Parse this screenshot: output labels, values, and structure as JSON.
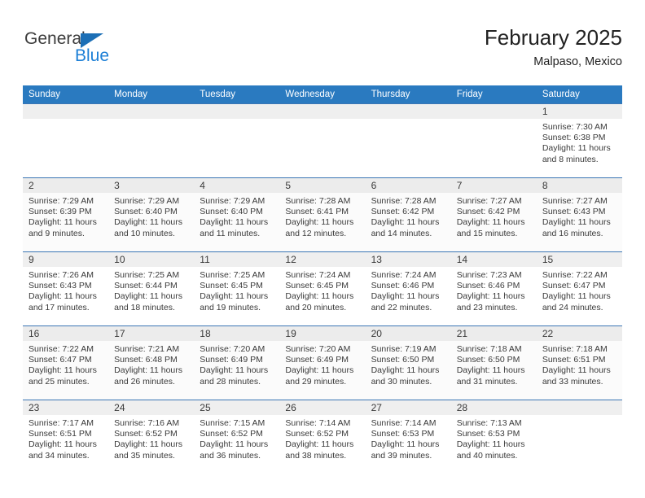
{
  "brand": {
    "name_top": "General",
    "name_bottom": "Blue",
    "accent_color": "#1c7fd6",
    "triangle_color": "#1c6fb6"
  },
  "header": {
    "title": "February 2025",
    "subtitle": "Malpaso, Mexico"
  },
  "theme": {
    "header_bg": "#2a7ac0",
    "row_border": "#3b76b5",
    "daynum_bg": "#efefef",
    "text": "#3a3a3a"
  },
  "weekday_headers": [
    "Sunday",
    "Monday",
    "Tuesday",
    "Wednesday",
    "Thursday",
    "Friday",
    "Saturday"
  ],
  "labels": {
    "sunrise": "Sunrise:",
    "sunset": "Sunset:",
    "daylight": "Daylight:"
  },
  "weeks": [
    {
      "shaded": false,
      "days": [
        {
          "date": "",
          "empty": true,
          "sunrise": "",
          "sunset": "",
          "daylight_1": "",
          "daylight_2": ""
        },
        {
          "date": "",
          "empty": true,
          "sunrise": "",
          "sunset": "",
          "daylight_1": "",
          "daylight_2": ""
        },
        {
          "date": "",
          "empty": true,
          "sunrise": "",
          "sunset": "",
          "daylight_1": "",
          "daylight_2": ""
        },
        {
          "date": "",
          "empty": true,
          "sunrise": "",
          "sunset": "",
          "daylight_1": "",
          "daylight_2": ""
        },
        {
          "date": "",
          "empty": true,
          "sunrise": "",
          "sunset": "",
          "daylight_1": "",
          "daylight_2": ""
        },
        {
          "date": "",
          "empty": true,
          "sunrise": "",
          "sunset": "",
          "daylight_1": "",
          "daylight_2": ""
        },
        {
          "date": "1",
          "empty": false,
          "sunrise": "Sunrise: 7:30 AM",
          "sunset": "Sunset: 6:38 PM",
          "daylight_1": "Daylight: 11 hours",
          "daylight_2": "and 8 minutes."
        }
      ]
    },
    {
      "shaded": true,
      "days": [
        {
          "date": "2",
          "empty": false,
          "sunrise": "Sunrise: 7:29 AM",
          "sunset": "Sunset: 6:39 PM",
          "daylight_1": "Daylight: 11 hours",
          "daylight_2": "and 9 minutes."
        },
        {
          "date": "3",
          "empty": false,
          "sunrise": "Sunrise: 7:29 AM",
          "sunset": "Sunset: 6:40 PM",
          "daylight_1": "Daylight: 11 hours",
          "daylight_2": "and 10 minutes."
        },
        {
          "date": "4",
          "empty": false,
          "sunrise": "Sunrise: 7:29 AM",
          "sunset": "Sunset: 6:40 PM",
          "daylight_1": "Daylight: 11 hours",
          "daylight_2": "and 11 minutes."
        },
        {
          "date": "5",
          "empty": false,
          "sunrise": "Sunrise: 7:28 AM",
          "sunset": "Sunset: 6:41 PM",
          "daylight_1": "Daylight: 11 hours",
          "daylight_2": "and 12 minutes."
        },
        {
          "date": "6",
          "empty": false,
          "sunrise": "Sunrise: 7:28 AM",
          "sunset": "Sunset: 6:42 PM",
          "daylight_1": "Daylight: 11 hours",
          "daylight_2": "and 14 minutes."
        },
        {
          "date": "7",
          "empty": false,
          "sunrise": "Sunrise: 7:27 AM",
          "sunset": "Sunset: 6:42 PM",
          "daylight_1": "Daylight: 11 hours",
          "daylight_2": "and 15 minutes."
        },
        {
          "date": "8",
          "empty": false,
          "sunrise": "Sunrise: 7:27 AM",
          "sunset": "Sunset: 6:43 PM",
          "daylight_1": "Daylight: 11 hours",
          "daylight_2": "and 16 minutes."
        }
      ]
    },
    {
      "shaded": false,
      "days": [
        {
          "date": "9",
          "empty": false,
          "sunrise": "Sunrise: 7:26 AM",
          "sunset": "Sunset: 6:43 PM",
          "daylight_1": "Daylight: 11 hours",
          "daylight_2": "and 17 minutes."
        },
        {
          "date": "10",
          "empty": false,
          "sunrise": "Sunrise: 7:25 AM",
          "sunset": "Sunset: 6:44 PM",
          "daylight_1": "Daylight: 11 hours",
          "daylight_2": "and 18 minutes."
        },
        {
          "date": "11",
          "empty": false,
          "sunrise": "Sunrise: 7:25 AM",
          "sunset": "Sunset: 6:45 PM",
          "daylight_1": "Daylight: 11 hours",
          "daylight_2": "and 19 minutes."
        },
        {
          "date": "12",
          "empty": false,
          "sunrise": "Sunrise: 7:24 AM",
          "sunset": "Sunset: 6:45 PM",
          "daylight_1": "Daylight: 11 hours",
          "daylight_2": "and 20 minutes."
        },
        {
          "date": "13",
          "empty": false,
          "sunrise": "Sunrise: 7:24 AM",
          "sunset": "Sunset: 6:46 PM",
          "daylight_1": "Daylight: 11 hours",
          "daylight_2": "and 22 minutes."
        },
        {
          "date": "14",
          "empty": false,
          "sunrise": "Sunrise: 7:23 AM",
          "sunset": "Sunset: 6:46 PM",
          "daylight_1": "Daylight: 11 hours",
          "daylight_2": "and 23 minutes."
        },
        {
          "date": "15",
          "empty": false,
          "sunrise": "Sunrise: 7:22 AM",
          "sunset": "Sunset: 6:47 PM",
          "daylight_1": "Daylight: 11 hours",
          "daylight_2": "and 24 minutes."
        }
      ]
    },
    {
      "shaded": true,
      "days": [
        {
          "date": "16",
          "empty": false,
          "sunrise": "Sunrise: 7:22 AM",
          "sunset": "Sunset: 6:47 PM",
          "daylight_1": "Daylight: 11 hours",
          "daylight_2": "and 25 minutes."
        },
        {
          "date": "17",
          "empty": false,
          "sunrise": "Sunrise: 7:21 AM",
          "sunset": "Sunset: 6:48 PM",
          "daylight_1": "Daylight: 11 hours",
          "daylight_2": "and 26 minutes."
        },
        {
          "date": "18",
          "empty": false,
          "sunrise": "Sunrise: 7:20 AM",
          "sunset": "Sunset: 6:49 PM",
          "daylight_1": "Daylight: 11 hours",
          "daylight_2": "and 28 minutes."
        },
        {
          "date": "19",
          "empty": false,
          "sunrise": "Sunrise: 7:20 AM",
          "sunset": "Sunset: 6:49 PM",
          "daylight_1": "Daylight: 11 hours",
          "daylight_2": "and 29 minutes."
        },
        {
          "date": "20",
          "empty": false,
          "sunrise": "Sunrise: 7:19 AM",
          "sunset": "Sunset: 6:50 PM",
          "daylight_1": "Daylight: 11 hours",
          "daylight_2": "and 30 minutes."
        },
        {
          "date": "21",
          "empty": false,
          "sunrise": "Sunrise: 7:18 AM",
          "sunset": "Sunset: 6:50 PM",
          "daylight_1": "Daylight: 11 hours",
          "daylight_2": "and 31 minutes."
        },
        {
          "date": "22",
          "empty": false,
          "sunrise": "Sunrise: 7:18 AM",
          "sunset": "Sunset: 6:51 PM",
          "daylight_1": "Daylight: 11 hours",
          "daylight_2": "and 33 minutes."
        }
      ]
    },
    {
      "shaded": false,
      "days": [
        {
          "date": "23",
          "empty": false,
          "sunrise": "Sunrise: 7:17 AM",
          "sunset": "Sunset: 6:51 PM",
          "daylight_1": "Daylight: 11 hours",
          "daylight_2": "and 34 minutes."
        },
        {
          "date": "24",
          "empty": false,
          "sunrise": "Sunrise: 7:16 AM",
          "sunset": "Sunset: 6:52 PM",
          "daylight_1": "Daylight: 11 hours",
          "daylight_2": "and 35 minutes."
        },
        {
          "date": "25",
          "empty": false,
          "sunrise": "Sunrise: 7:15 AM",
          "sunset": "Sunset: 6:52 PM",
          "daylight_1": "Daylight: 11 hours",
          "daylight_2": "and 36 minutes."
        },
        {
          "date": "26",
          "empty": false,
          "sunrise": "Sunrise: 7:14 AM",
          "sunset": "Sunset: 6:52 PM",
          "daylight_1": "Daylight: 11 hours",
          "daylight_2": "and 38 minutes."
        },
        {
          "date": "27",
          "empty": false,
          "sunrise": "Sunrise: 7:14 AM",
          "sunset": "Sunset: 6:53 PM",
          "daylight_1": "Daylight: 11 hours",
          "daylight_2": "and 39 minutes."
        },
        {
          "date": "28",
          "empty": false,
          "sunrise": "Sunrise: 7:13 AM",
          "sunset": "Sunset: 6:53 PM",
          "daylight_1": "Daylight: 11 hours",
          "daylight_2": "and 40 minutes."
        },
        {
          "date": "",
          "empty": true,
          "sunrise": "",
          "sunset": "",
          "daylight_1": "",
          "daylight_2": ""
        }
      ]
    }
  ]
}
